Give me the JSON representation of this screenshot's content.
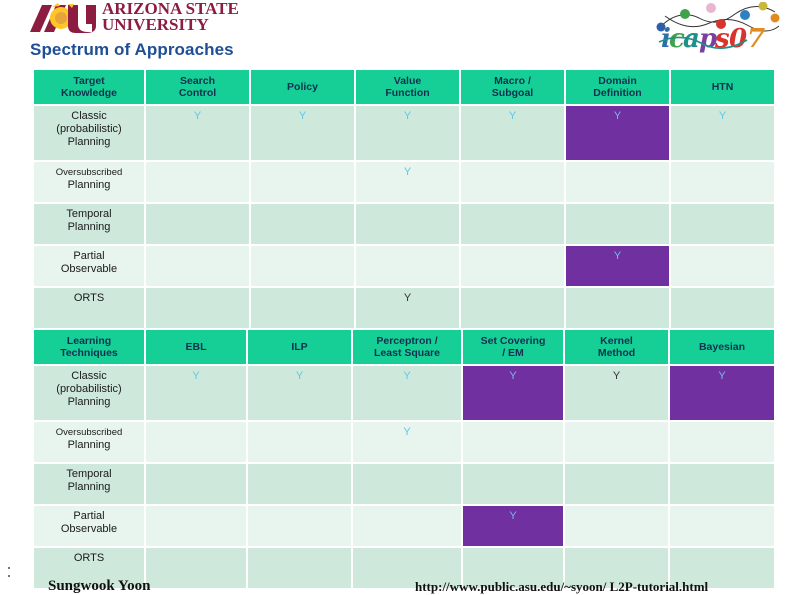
{
  "branding": {
    "asu_mark_text": "ASU",
    "asu_line1": "ARIZONA STATE",
    "asu_line2": "UNIVERSITY",
    "icaps_logo_text": "icaps07"
  },
  "page_title": "Spectrum of Approaches",
  "colors": {
    "header_bg": "#15cf97",
    "header_text": "#12304f",
    "row_band_a": "#cfe8dc",
    "row_band_b": "#e8f4ee",
    "highlight": "#7030a0",
    "mark": "#62c7e3",
    "title": "#1f4e96",
    "asu_maroon": "#8c1d40",
    "asu_gold": "#ffc627"
  },
  "mark_symbol": "Y",
  "tables": [
    {
      "id": "approaches",
      "headers": [
        "Target Knowledge",
        "Search Control",
        "Policy",
        "Value Function",
        "Macro / Subgoal",
        "Domain Definition",
        "HTN"
      ],
      "header_lines": [
        [
          "Target",
          "Knowledge"
        ],
        [
          "Search",
          "Control"
        ],
        [
          "Policy",
          ""
        ],
        [
          "Value",
          "Function"
        ],
        [
          "Macro /",
          "Subgoal"
        ],
        [
          "Domain",
          "Definition"
        ],
        [
          "HTN",
          ""
        ]
      ],
      "rows": [
        {
          "label_lines": [
            "Classic",
            "(probabilistic)",
            "Planning"
          ],
          "label": "Classic (probabilistic) Planning",
          "cells": [
            "Y",
            "Y",
            "Y",
            "Y",
            "Y",
            "Y"
          ],
          "highlight": [
            false,
            false,
            false,
            false,
            true,
            false
          ]
        },
        {
          "label_lines": [
            "Oversubscribed",
            "Planning"
          ],
          "label": "Oversubscribed Planning",
          "cells": [
            "",
            "",
            "Y",
            "",
            "",
            ""
          ],
          "highlight": [
            false,
            false,
            false,
            false,
            false,
            false
          ]
        },
        {
          "label_lines": [
            "Temporal",
            "Planning"
          ],
          "label": "Temporal Planning",
          "cells": [
            "",
            "",
            "",
            "",
            "",
            ""
          ],
          "highlight": [
            false,
            false,
            false,
            false,
            false,
            false
          ]
        },
        {
          "label_lines": [
            "Partial",
            "Observable"
          ],
          "label": "Partial Observable",
          "cells": [
            "",
            "",
            "",
            "",
            "Y",
            ""
          ],
          "highlight": [
            false,
            false,
            false,
            false,
            true,
            false
          ]
        },
        {
          "label_lines": [
            "ORTS"
          ],
          "label": "ORTS",
          "cells": [
            "",
            "",
            "Y",
            "",
            "",
            ""
          ],
          "highlight": [
            false,
            false,
            false,
            false,
            false,
            false
          ]
        }
      ]
    },
    {
      "id": "learning",
      "headers": [
        "Learning Techniques",
        "EBL",
        "ILP",
        "Perceptron / Least Square",
        "Set Covering / EM",
        "Kernel Method",
        "Bayesian"
      ],
      "header_lines": [
        [
          "Learning",
          "Techniques"
        ],
        [
          "EBL",
          ""
        ],
        [
          "ILP",
          ""
        ],
        [
          "Perceptron /",
          "Least Square"
        ],
        [
          "Set Covering",
          "/ EM"
        ],
        [
          "Kernel",
          "Method"
        ],
        [
          "Bayesian",
          ""
        ]
      ],
      "rows": [
        {
          "label_lines": [
            "Classic",
            "(probabilistic)",
            "Planning"
          ],
          "label": "Classic (probabilistic) Planning",
          "cells": [
            "Y",
            "Y",
            "Y",
            "Y",
            "Y",
            "Y"
          ],
          "highlight": [
            false,
            false,
            false,
            true,
            false,
            true
          ]
        },
        {
          "label_lines": [
            "Oversubscribed",
            "Planning"
          ],
          "label": "Oversubscribed Planning",
          "cells": [
            "",
            "",
            "Y",
            "",
            "",
            ""
          ],
          "highlight": [
            false,
            false,
            false,
            false,
            false,
            false
          ]
        },
        {
          "label_lines": [
            "Temporal",
            "Planning"
          ],
          "label": "Temporal Planning",
          "cells": [
            "",
            "",
            "",
            "",
            "",
            ""
          ],
          "highlight": [
            false,
            false,
            false,
            false,
            false,
            false
          ]
        },
        {
          "label_lines": [
            "Partial",
            "Observable"
          ],
          "label": "Partial Observable",
          "cells": [
            "",
            "",
            "",
            "Y",
            "",
            ""
          ],
          "highlight": [
            false,
            false,
            false,
            true,
            false,
            false
          ]
        },
        {
          "label_lines": [
            "ORTS"
          ],
          "label": "ORTS",
          "cells": [
            "",
            "",
            "",
            "",
            "",
            ""
          ],
          "highlight": [
            false,
            false,
            false,
            false,
            false,
            false
          ]
        }
      ]
    }
  ],
  "footer": {
    "author": "Sungwook Yoon",
    "url": "http://www.public.asu.edu/~syoon/ L2P-tutorial.html"
  }
}
